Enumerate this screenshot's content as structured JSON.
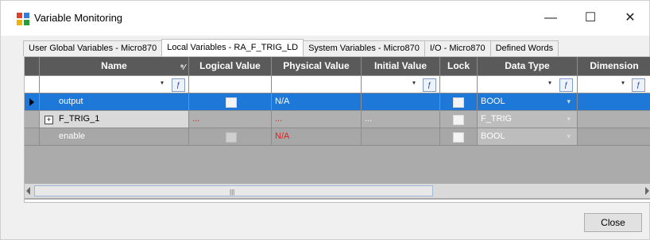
{
  "window": {
    "title": "Variable Monitoring",
    "minimize": "—",
    "maximize": "☐",
    "close": "✕"
  },
  "tabs": [
    "User Global Variables - Micro870",
    "Local Variables - RA_F_TRIG_LD",
    "System Variables - Micro870",
    "I/O - Micro870",
    "Defined Words"
  ],
  "grid": {
    "columns": [
      "Name",
      "Logical Value",
      "Physical Value",
      "Initial Value",
      "Lock",
      "Data Type",
      "Dimension"
    ],
    "rows": [
      {
        "name": "output",
        "logical": "",
        "physical": "N/A",
        "initial": "",
        "data_type": "BOOL"
      },
      {
        "name": "F_TRIG_1",
        "logical": "...",
        "physical": "...",
        "initial": "...",
        "data_type": "F_TRIG"
      },
      {
        "name": "enable",
        "logical": "",
        "physical": "N/A",
        "initial": "",
        "data_type": "BOOL"
      }
    ]
  },
  "buttons": {
    "close": "Close"
  },
  "colors": {
    "selection": "#1e78d7",
    "header": "#5a5a5a",
    "error_text": "#e02020"
  }
}
